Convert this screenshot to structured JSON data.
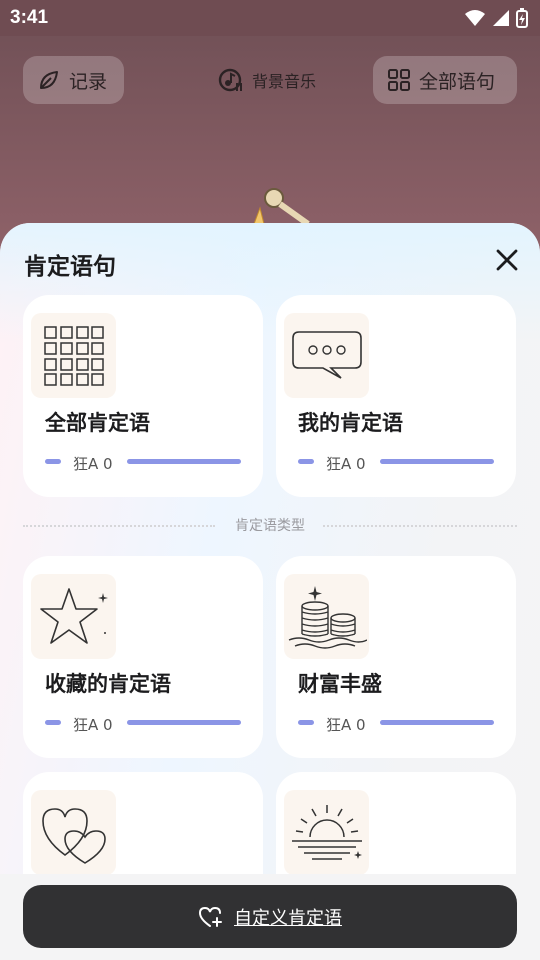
{
  "status_bar": {
    "time": "3:41"
  },
  "topbar": {
    "record_label": "记录",
    "music_label": "背景音乐",
    "all_sentences_label": "全部语句"
  },
  "sheet": {
    "title": "肯定语句",
    "divider_label": "肯定语类型",
    "cards": [
      {
        "title": "全部肯定语",
        "count_text": "狂A 0",
        "icon": "grid-icon"
      },
      {
        "title": "我的肯定语",
        "count_text": "狂A 0",
        "icon": "speech-bubble-icon"
      },
      {
        "title": "收藏的肯定语",
        "count_text": "狂A 0",
        "icon": "star-icon"
      },
      {
        "title": "财富丰盛",
        "count_text": "狂A 0",
        "icon": "coins-icon"
      },
      {
        "title": "",
        "count_text": "",
        "icon": "hearts-icon"
      },
      {
        "title": "",
        "count_text": "",
        "icon": "sunrise-icon"
      }
    ]
  },
  "custom_button_label": "自定义肯定语",
  "colors": {
    "accent_bar": "#8b95e6",
    "button_bg": "#313133",
    "thumb_bg": "#fbf5ef"
  }
}
